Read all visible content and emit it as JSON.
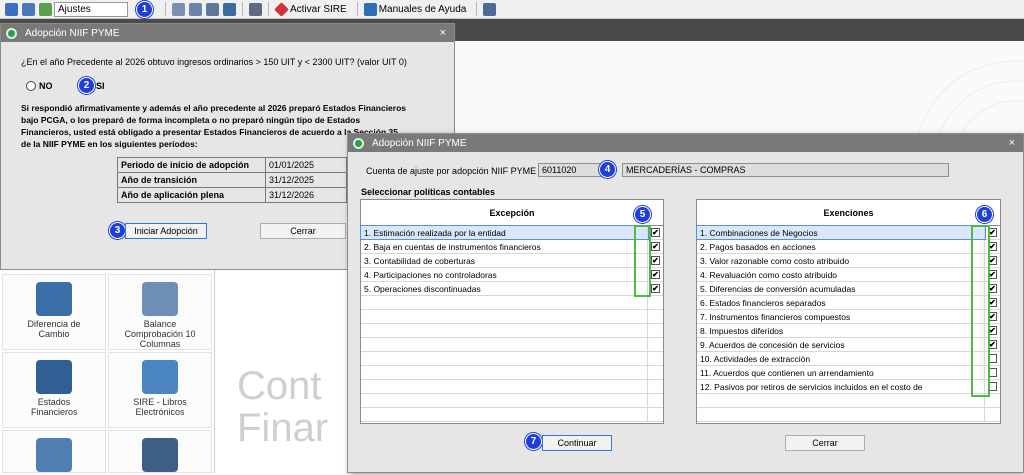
{
  "toolbar": {
    "ajustes_value": "Ajustes",
    "activar_sire": "Activar SIRE",
    "manuales": "Manuales de Ayuda",
    "badge1": "1"
  },
  "dialog1": {
    "title": "Adopción NIIF PYME",
    "close": "×",
    "question": "¿En el año Precedente al 2026 obtuvo ingresos ordinarios > 150 UIT y < 2300 UIT? (valor UIT 0)",
    "no_label": "NO",
    "si_label": "SI",
    "badge2": "2",
    "info": "Si respondió afirmativamente y además el año precedente al 2026 preparó Estados Financieros bajo PCGA, o los preparó de forma incompleta o no preparó ningún tipo de Estados Financieros, usted está obligado a presentar Estados Financieros de acuerdo a la Sección 35 de la NIIF PYME en los siguientes períodos:",
    "rows": [
      {
        "label": "Periodo de inicio de adopción",
        "value": "01/01/2025"
      },
      {
        "label": "Año de transición",
        "value": "31/12/2025"
      },
      {
        "label": "Año de aplicación plena",
        "value": "31/12/2026"
      }
    ],
    "badge3": "3",
    "iniciar": "Iniciar Adopción",
    "cerrar": "Cerrar"
  },
  "tiles": [
    {
      "label": "Diferencia de Cambio"
    },
    {
      "label": "Balance Comprobación 10 Columnas"
    },
    {
      "label": "Estados Financieros"
    },
    {
      "label": "SIRE - Libros Electrónicos"
    }
  ],
  "background": {
    "line1": "Cont",
    "line2": "Finar"
  },
  "dialog2": {
    "title": "Adopción NIIF PYME",
    "close": "×",
    "cuenta_label": "Cuenta de ajuste por adopción NIIF PYME",
    "cuenta_code": "6011020",
    "cuenta_name": "MERCADERÍAS - COMPRAS",
    "badge4": "4",
    "seleccionar": "Seleccionar políticas contables",
    "excepcion_header": "Excepción",
    "exenciones_header": "Exenciones",
    "badge5": "5",
    "badge6": "6",
    "excepciones": [
      {
        "label": "1. Estimación realizada por la entidad",
        "checked": true
      },
      {
        "label": "2. Baja en cuentas de instrumentos financieros",
        "checked": true
      },
      {
        "label": "3. Contabilidad de coberturas",
        "checked": true
      },
      {
        "label": "4. Participaciones no controladoras",
        "checked": true
      },
      {
        "label": "5. Operaciones discontinuadas",
        "checked": true
      }
    ],
    "exenciones": [
      {
        "label": "1. Combinaciones de Negocios",
        "checked": true
      },
      {
        "label": "2. Pagos basados en acciones",
        "checked": true
      },
      {
        "label": "3. Valor razonable como costo atribuido",
        "checked": true
      },
      {
        "label": "4. Revaluación como costo atribuido",
        "checked": true
      },
      {
        "label": "5. Diferencias de conversión acumuladas",
        "checked": true
      },
      {
        "label": "6. Estados financieros separados",
        "checked": true
      },
      {
        "label": "7. Instrumentos financieros compuestos",
        "checked": true
      },
      {
        "label": "8. Impuestos diferidos",
        "checked": true
      },
      {
        "label": "9. Acuerdos de concesión de servicios",
        "checked": true
      },
      {
        "label": "10. Actividades de extracción",
        "checked": false
      },
      {
        "label": "11. Acuerdos que contienen un arrendamiento",
        "checked": false
      },
      {
        "label": "12. Pasivos por retiros de servicios incluidos en el costo de",
        "checked": false
      }
    ],
    "badge7": "7",
    "continuar": "Continuar",
    "cerrar": "Cerrar"
  }
}
